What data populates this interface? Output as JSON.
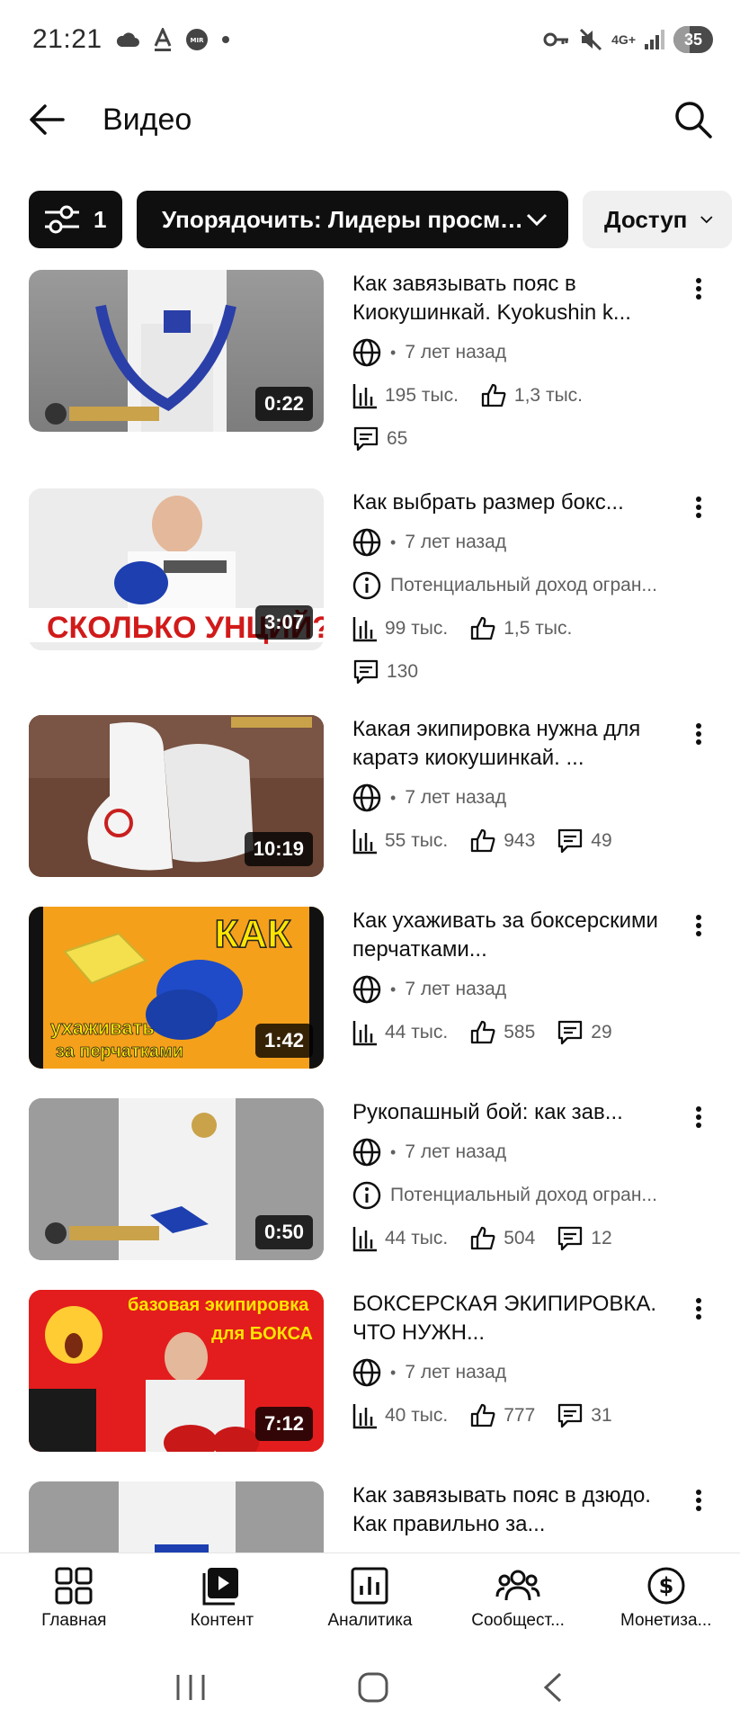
{
  "status_bar": {
    "time": "21:21",
    "network": "4G+",
    "battery": "35"
  },
  "header": {
    "title": "Видео"
  },
  "filters": {
    "filter_count": "1",
    "sort_label": "Упорядочить: Лидеры просмот...",
    "access_label": "Доступ"
  },
  "videos": [
    {
      "title": "Как завязывать пояс в Киокушинкай. Kyokushin k...",
      "duration": "0:22",
      "age": "7 лет назад",
      "views": "195 тыс.",
      "likes": "1,3 тыс.",
      "comments": "65",
      "monetization": ""
    },
    {
      "title": "Как выбрать размер бокс...",
      "duration": "3:07",
      "age": "7 лет назад",
      "views": "99 тыс.",
      "likes": "1,5 тыс.",
      "comments": "130",
      "monetization": "Потенциальный доход огран...",
      "thumb_caption": "СКОЛЬКО УНЦИЙ?"
    },
    {
      "title": "Какая экипировка нужна для каратэ киокушинкай. ...",
      "duration": "10:19",
      "age": "7 лет назад",
      "views": "55 тыс.",
      "likes": "943",
      "comments": "49"
    },
    {
      "title": "Как ухаживать за боксерскими перчатками...",
      "duration": "1:42",
      "age": "7 лет назад",
      "views": "44 тыс.",
      "likes": "585",
      "comments": "29",
      "thumb_caption_top": "КАК",
      "thumb_caption_bottom1": "ухаживать",
      "thumb_caption_bottom2": "за перчатками"
    },
    {
      "title": "Рукопашный бой: как зав...",
      "duration": "0:50",
      "age": "7 лет назад",
      "views": "44 тыс.",
      "likes": "504",
      "comments": "12",
      "monetization": "Потенциальный доход огран..."
    },
    {
      "title": "БОКСЕРСКАЯ ЭКИПИРОВКА. ЧТО НУЖН...",
      "duration": "7:12",
      "age": "7 лет назад",
      "views": "40 тыс.",
      "likes": "777",
      "comments": "31",
      "thumb_caption_top": "базовая экипировка",
      "thumb_caption_mid": "для БОКСА"
    },
    {
      "title": "Как завязывать пояс в дзюдо. Как правильно за..."
    }
  ],
  "bottom_nav": {
    "home": "Главная",
    "content": "Контент",
    "analytics": "Аналитика",
    "community": "Сообщест...",
    "monetization": "Монетиза..."
  }
}
